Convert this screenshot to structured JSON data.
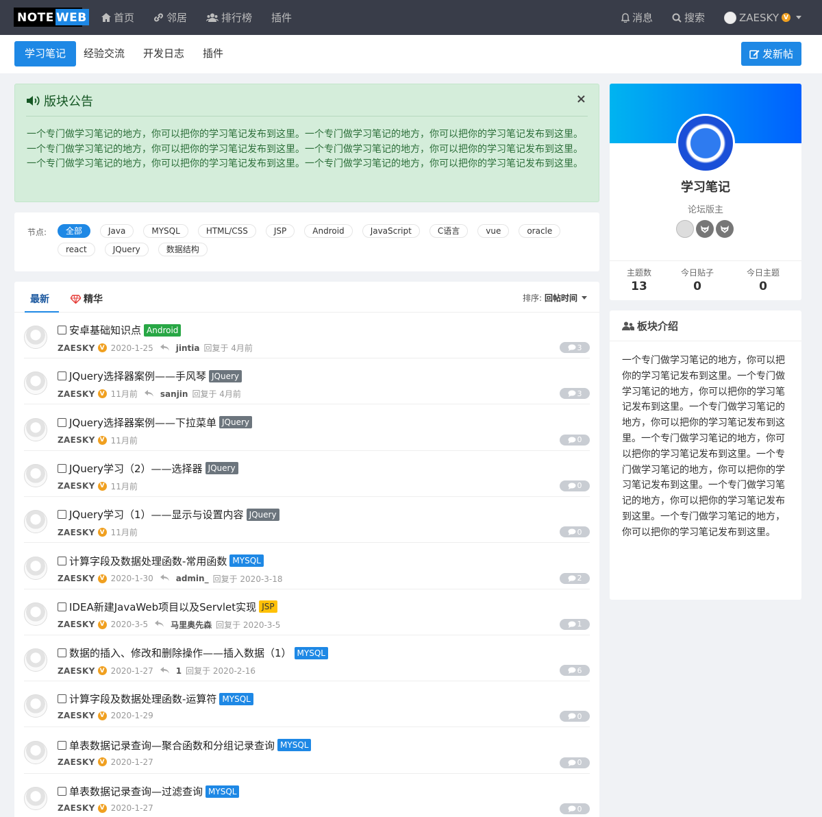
{
  "logo": {
    "part1": "NOTE",
    "part2": "WEB"
  },
  "nav": {
    "home": "首页",
    "neighbors": "邻居",
    "ranking": "排行榜",
    "plugins": "插件"
  },
  "nav_right": {
    "messages": "消息",
    "search": "搜索",
    "user": "ZAESKY",
    "vip": "V"
  },
  "subnav": {
    "tabs": [
      "学习笔记",
      "经验交流",
      "开发日志",
      "插件"
    ],
    "post_button": "发新帖"
  },
  "notice": {
    "title": "版块公告",
    "close": "×",
    "body": "一个专门做学习笔记的地方，你可以把你的学习笔记发布到这里。一个专门做学习笔记的地方，你可以把你的学习笔记发布到这里。一个专门做学习笔记的地方，你可以把你的学习笔记发布到这里。一个专门做学习笔记的地方，你可以把你的学习笔记发布到这里。一个专门做学习笔记的地方，你可以把你的学习笔记发布到这里。一个专门做学习笔记的地方，你可以把你的学习笔记发布到这里。"
  },
  "nodes": {
    "label": "节点:",
    "items": [
      "全部",
      "Java",
      "MYSQL",
      "HTML/CSS",
      "JSP",
      "Android",
      "JavaScript",
      "C语言",
      "vue",
      "oracle",
      "react",
      "JQuery",
      "数据结构"
    ]
  },
  "list": {
    "tab_latest": "最新",
    "tab_featured": "精华",
    "sort_label": "排序:",
    "sort_value": "回帖时间",
    "rows": [
      {
        "title": "安卓基础知识点",
        "tag": "Android",
        "tag_type": "android",
        "author": "ZAESKY",
        "time": "2020-1-25",
        "reply_user": "jintia",
        "reply_time": "回复于 4月前",
        "count": "3"
      },
      {
        "title": "JQuery选择器案例——手风琴",
        "tag": "JQuery",
        "tag_type": "jquery",
        "author": "ZAESKY",
        "time": "11月前",
        "reply_user": "sanjin",
        "reply_time": "回复于 4月前",
        "count": "3"
      },
      {
        "title": "JQuery选择器案例——下拉菜单",
        "tag": "JQuery",
        "tag_type": "jquery",
        "author": "ZAESKY",
        "time": "11月前",
        "reply_user": "",
        "reply_time": "",
        "count": "0"
      },
      {
        "title": "JQuery学习（2）——选择器",
        "tag": "JQuery",
        "tag_type": "jquery",
        "author": "ZAESKY",
        "time": "11月前",
        "reply_user": "",
        "reply_time": "",
        "count": "0"
      },
      {
        "title": "JQuery学习（1）——显示与设置内容",
        "tag": "JQuery",
        "tag_type": "jquery",
        "author": "ZAESKY",
        "time": "11月前",
        "reply_user": "",
        "reply_time": "",
        "count": "0"
      },
      {
        "title": "计算字段及数据处理函数-常用函数",
        "tag": "MYSQL",
        "tag_type": "mysql",
        "author": "ZAESKY",
        "time": "2020-1-30",
        "reply_user": "admin_",
        "reply_time": "回复于 2020-3-18",
        "count": "2"
      },
      {
        "title": "IDEA新建JavaWeb项目以及Servlet实现",
        "tag": "JSP",
        "tag_type": "jsp",
        "author": "ZAESKY",
        "time": "2020-3-5",
        "reply_user": "马里奥先森",
        "reply_time": "回复于 2020-3-5",
        "count": "1"
      },
      {
        "title": "数据的插入、修改和删除操作——插入数据（1）",
        "tag": "MYSQL",
        "tag_type": "mysql",
        "author": "ZAESKY",
        "time": "2020-1-27",
        "reply_user": "1",
        "reply_time": "回复于 2020-2-16",
        "count": "6"
      },
      {
        "title": "计算字段及数据处理函数-运算符",
        "tag": "MYSQL",
        "tag_type": "mysql",
        "author": "ZAESKY",
        "time": "2020-1-29",
        "reply_user": "",
        "reply_time": "",
        "count": "0"
      },
      {
        "title": "单表数据记录查询—聚合函数和分组记录查询",
        "tag": "MYSQL",
        "tag_type": "mysql",
        "author": "ZAESKY",
        "time": "2020-1-27",
        "reply_user": "",
        "reply_time": "",
        "count": "0"
      },
      {
        "title": "单表数据记录查询—过滤查询",
        "tag": "MYSQL",
        "tag_type": "mysql",
        "author": "ZAESKY",
        "time": "2020-1-27",
        "reply_user": "",
        "reply_time": "",
        "count": "0"
      }
    ]
  },
  "forum": {
    "name": "学习笔记",
    "role": "论坛版主",
    "stats": [
      {
        "label": "主题数",
        "value": "13"
      },
      {
        "label": "今日贴子",
        "value": "0"
      },
      {
        "label": "今日主题",
        "value": "0"
      }
    ]
  },
  "intro": {
    "title": "板块介绍",
    "body": "一个专门做学习笔记的地方，你可以把你的学习笔记发布到这里。一个专门做学习笔记的地方，你可以把你的学习笔记发布到这里。一个专门做学习笔记的地方，你可以把你的学习笔记发布到这里。一个专门做学习笔记的地方，你可以把你的学习笔记发布到这里。一个专门做学习笔记的地方，你可以把你的学习笔记发布到这里。一个专门做学习笔记的地方，你可以把你的学习笔记发布到这里。一个专门做学习笔记的地方，你可以把你的学习笔记发布到这里。"
  },
  "colors": {
    "primary": "#1e88e5",
    "topbar": "#393d49",
    "notice_bg": "#d4edda",
    "android": "#28a745",
    "jquery": "#6c757d",
    "jsp": "#ffc107",
    "vip": "#f0a020"
  }
}
